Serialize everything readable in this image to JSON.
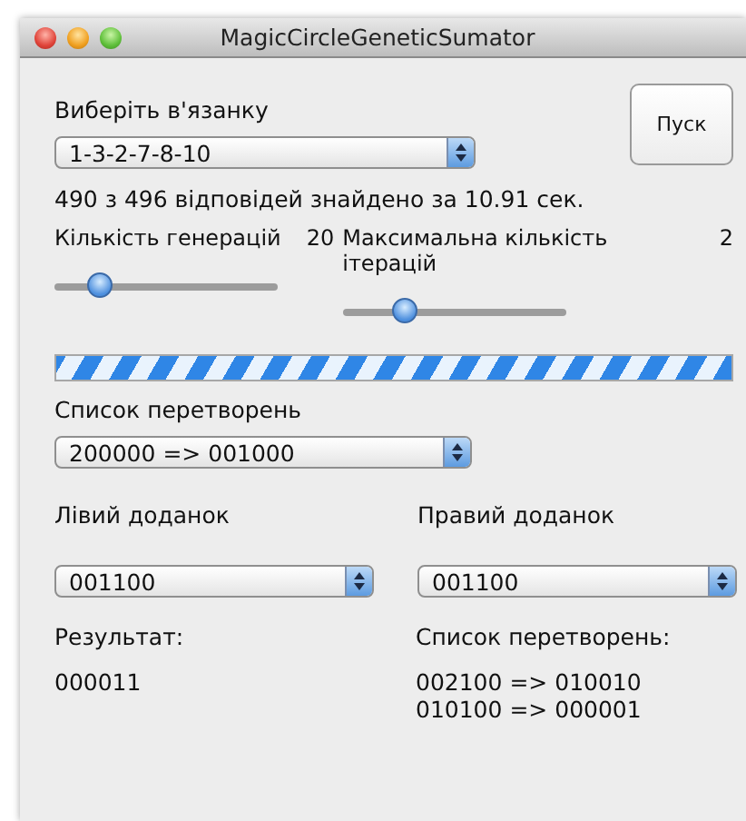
{
  "window": {
    "title": "MagicCircleGeneticSumator"
  },
  "run_button": {
    "label": "Пуск"
  },
  "bundle": {
    "label": "Виберіть в'язанку",
    "value": "1-3-2-7-8-10"
  },
  "status": "490 з 496 відповідей знайдено за 10.91 сек.",
  "sliders": [
    {
      "label": "Кількість генерацій",
      "reading": "20",
      "level": 0.2
    },
    {
      "label": "Максимальна кількість ітерацій",
      "reading": "2",
      "level": 0.28
    }
  ],
  "progress": {
    "indeterminate": true
  },
  "transforms": {
    "label": "Список перетворень",
    "value": "200000 => 001000"
  },
  "left_addend": {
    "label": "Лівий доданок",
    "value": "001100"
  },
  "right_addend": {
    "label": "Правий доданок",
    "value": "001100"
  },
  "result": {
    "label": "Результат:",
    "value": "000011"
  },
  "transform_list": {
    "label": "Список перетворень:",
    "lines": [
      "002100 => 010010",
      "010100 => 000001"
    ]
  }
}
